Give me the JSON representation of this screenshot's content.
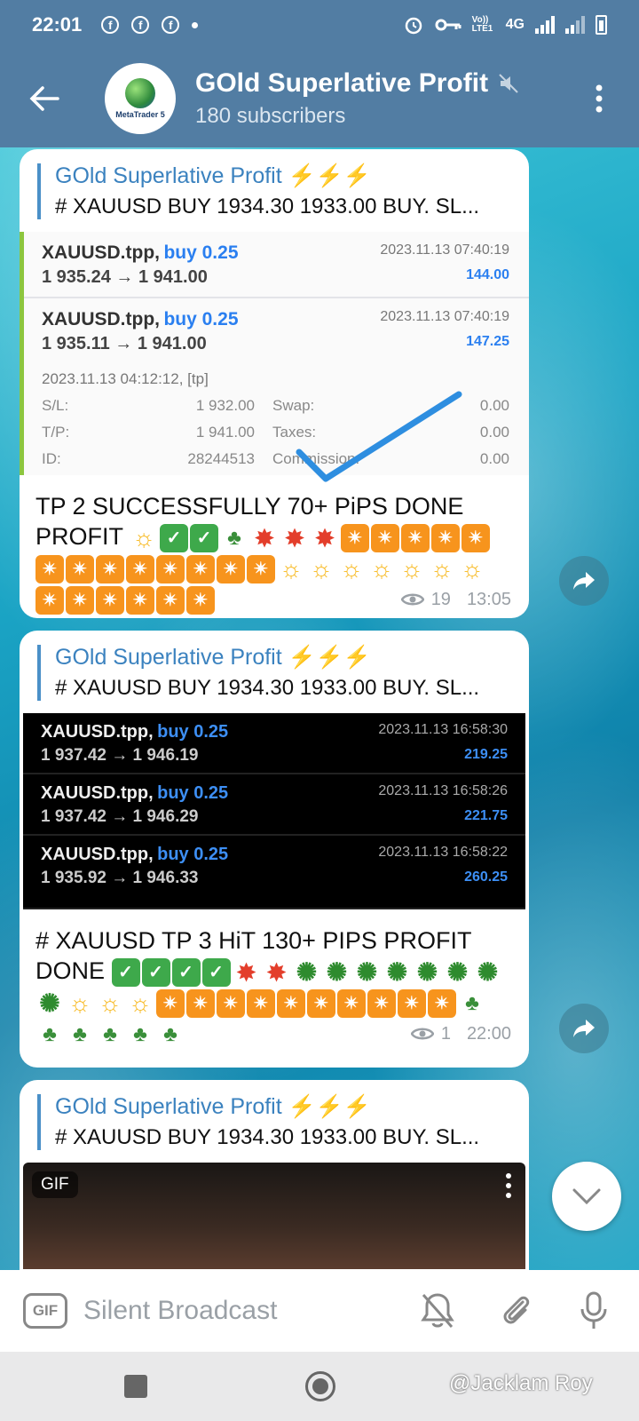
{
  "status_bar": {
    "time": "22:01",
    "network": "4G",
    "volte": "Vo)) LTE1",
    "icons": [
      "facebook-icon",
      "facebook-icon",
      "facebook-icon",
      "dot-icon",
      "alarm-icon",
      "vpn-key-icon",
      "signal-icon",
      "battery-icon"
    ]
  },
  "header": {
    "title": "GOld Superlative Profit",
    "subtitle": "180 subscribers",
    "avatar_text": "MetaTrader 5",
    "muted_icon": "mute-icon"
  },
  "posts": [
    {
      "reply_name": "GOld Superlative Profit ⚡⚡⚡",
      "reply_text": "# XAUUSD BUY 1934.30  1933.00 BUY.   SL...",
      "trades": [
        {
          "symbol": "XAUUSD.tpp,",
          "side": "buy 0.25",
          "prices": "1 935.24 → 1 941.00",
          "date": "2023.11.13 07:40:19",
          "profit": "144.00"
        },
        {
          "symbol": "XAUUSD.tpp,",
          "side": "buy 0.25",
          "prices": "1 935.11 → 1 941.00",
          "date": "2023.11.13 07:40:19",
          "profit": "147.25"
        }
      ],
      "details": {
        "opened": "2023.11.13 04:12:12, [tp]",
        "rows": [
          {
            "k1": "S/L:",
            "v1": "1 932.00",
            "k2": "Swap:",
            "v2": "0.00"
          },
          {
            "k1": "T/P:",
            "v1": "1 941.00",
            "k2": "Taxes:",
            "v2": "0.00"
          },
          {
            "k1": "ID:",
            "v1": "28244513",
            "k2": "Commission:",
            "v2": "0.00"
          }
        ]
      },
      "text_line1": "TP 2 SUCCESSFULLY 70+ PiPS DONE",
      "text_line2": "PROFIT",
      "views": "19",
      "time": "13:05"
    },
    {
      "reply_name": "GOld Superlative Profit ⚡⚡⚡",
      "reply_text": "# XAUUSD BUY 1934.30  1933.00 BUY.   SL...",
      "trades": [
        {
          "symbol": "XAUUSD.tpp,",
          "side": "buy 0.25",
          "prices": "1 937.42 → 1 946.19",
          "date": "2023.11.13 16:58:30",
          "profit": "219.25"
        },
        {
          "symbol": "XAUUSD.tpp,",
          "side": "buy 0.25",
          "prices": "1 937.42 → 1 946.29",
          "date": "2023.11.13 16:58:26",
          "profit": "221.75"
        },
        {
          "symbol": "XAUUSD.tpp,",
          "side": "buy 0.25",
          "prices": "1 935.92 → 1 946.33",
          "date": "2023.11.13 16:58:22",
          "profit": "260.25"
        }
      ],
      "text_line1": "# XAUUSD TP 3 HiT 130+ PIPS PROFIT",
      "text_line2": "DONE",
      "views": "1",
      "time": "22:00"
    },
    {
      "reply_name": "GOld Superlative Profit ⚡⚡⚡",
      "reply_text": "# XAUUSD BUY 1934.30  1933.00 BUY.   SL...",
      "gif_label": "GIF"
    }
  ],
  "input": {
    "gif_label": "GIF",
    "placeholder": "Silent Broadcast"
  },
  "watermark": "@Jacklam Roy",
  "colors": {
    "header_bg": "#527da3",
    "accent_blue": "#3b82bf",
    "buy_blue": "#2a7ff0"
  }
}
